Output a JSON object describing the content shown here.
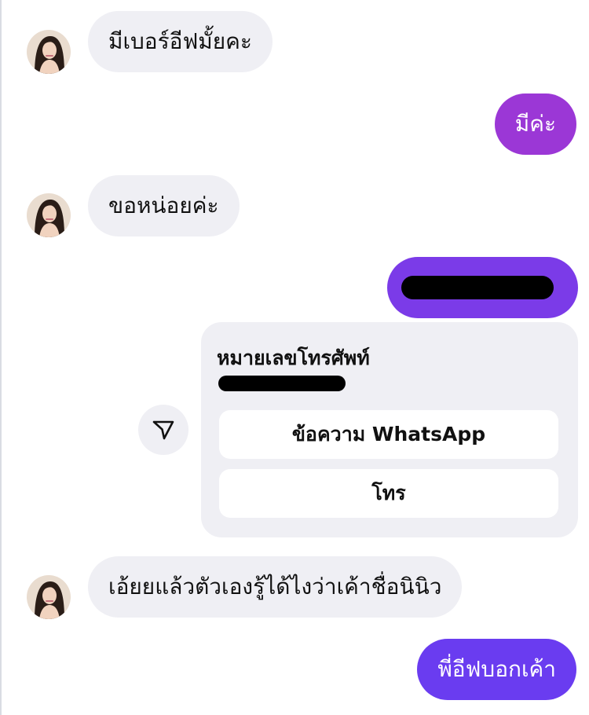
{
  "conversation": {
    "messages": [
      {
        "direction": "incoming",
        "text": "มีเบอร์อีฟมั้ยคะ"
      },
      {
        "direction": "outgoing",
        "text": "มีค่ะ"
      },
      {
        "direction": "incoming",
        "text": "ขอหน่อยค่ะ"
      },
      {
        "direction": "outgoing",
        "text": ""
      },
      {
        "direction": "incoming",
        "text": "เอ้ยยแล้วตัวเองรู้ได้ไงว่าเค้าชื่อนินิว"
      },
      {
        "direction": "outgoing",
        "text": "พี่อีฟบอกเค้า"
      }
    ]
  },
  "phone_card": {
    "title": "หมายเลขโทรศัพท์",
    "whatsapp_label": "ข้อความ WhatsApp",
    "call_label": "โทร"
  },
  "icons": {
    "share": "send-arrow-icon",
    "avatar": "profile-photo"
  },
  "colors": {
    "incoming_bubble": "#efeff4",
    "outgoing_purple": "#9b37d6",
    "outgoing_violet": "#7b3be8",
    "outgoing_indigo": "#6a3cf0"
  }
}
